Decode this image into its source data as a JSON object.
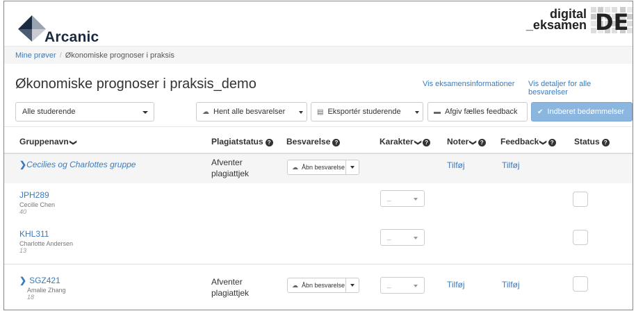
{
  "brand": {
    "name": "Arcanic",
    "partner_line1": "digital",
    "partner_line2": "_eksamen",
    "partner_mark": "DE"
  },
  "breadcrumb": {
    "home": "Mine prøver",
    "current": "Økonomiske prognoser i praksis"
  },
  "page": {
    "title": "Økonomiske prognoser i praksis_demo",
    "link_info": "Vis eksamensinformationer",
    "link_details": "Vis detaljer for alle besvarelser"
  },
  "toolbar": {
    "filter_value": "Alle studerende",
    "fetch_all": "Hent alle besvarelser",
    "export": "Eksportér studerende",
    "feedback": "Afgiv fælles feedback",
    "submit": "Indberet bedømmelser"
  },
  "columns": {
    "group": "Gruppenavn",
    "plagiarism": "Plagiatstatus",
    "submission": "Besvarelse",
    "grade": "Karakter",
    "notes": "Noter",
    "feedback": "Feedback",
    "status": "Status"
  },
  "group": {
    "name": "Cecilies og Charlottes gruppe",
    "plagiarism": "Afventer plagiattjek",
    "open_btn": "Åbn besvarelse",
    "notes": "Tilføj",
    "feedback": "Tilføj"
  },
  "students": [
    {
      "id": "JPH289",
      "name": "Cecille Chen",
      "num": "40",
      "grade": "_"
    },
    {
      "id": "KHL311",
      "name": "Charlotte Andersen",
      "num": "13",
      "grade": "_"
    }
  ],
  "single": {
    "id": "SGZ421",
    "name": "Amalie Zhang",
    "num": "18",
    "plagiarism": "Afventer plagiattjek",
    "open_btn": "Åbn besvarelse",
    "grade": "_",
    "notes": "Tilføj",
    "feedback": "Tilføj"
  },
  "colors": {
    "link": "#3a7bbf",
    "primary": "#8ab6e0"
  }
}
